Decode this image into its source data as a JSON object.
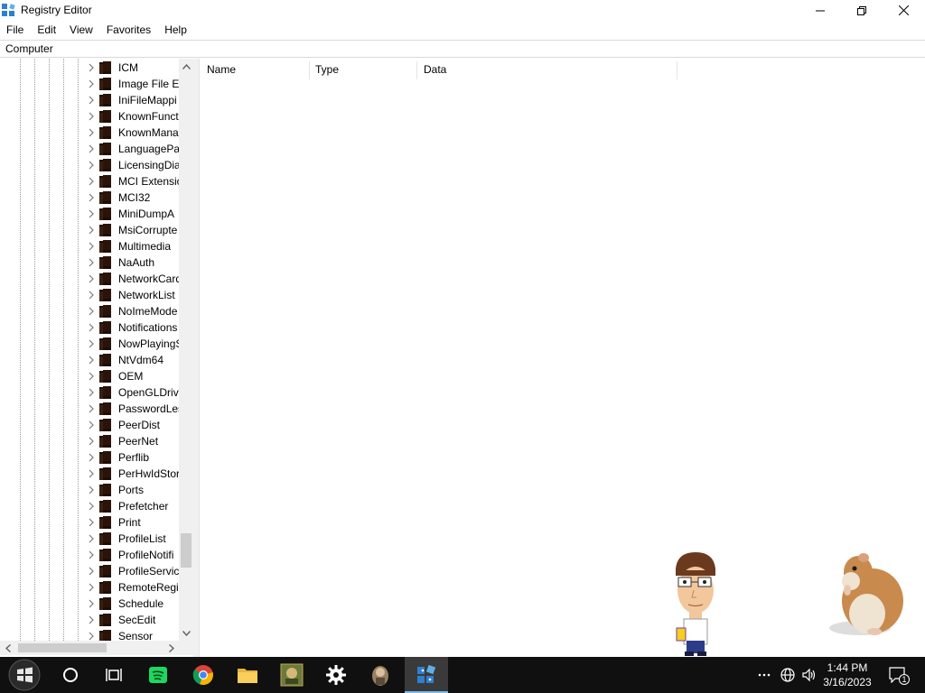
{
  "window": {
    "title": "Registry Editor",
    "icon": "regedit-icon",
    "controls": [
      "minimize-icon",
      "restore-icon",
      "close-icon"
    ]
  },
  "menu": [
    "File",
    "Edit",
    "View",
    "Favorites",
    "Help"
  ],
  "address": "Computer",
  "tree": {
    "items": [
      "ICM",
      "Image File Ex",
      "IniFileMappi",
      "KnownFunct",
      "KnownMana",
      "LanguagePa",
      "LicensingDia",
      "MCI Extensio",
      "MCI32",
      "MiniDumpA",
      "MsiCorrupte",
      "Multimedia",
      "NaAuth",
      "NetworkCard",
      "NetworkList",
      "NoImeMode",
      "Notifications",
      "NowPlayingS",
      "NtVdm64",
      "OEM",
      "OpenGLDrive",
      "PasswordLes",
      "PeerDist",
      "PeerNet",
      "Perflib",
      "PerHwIdStor",
      "Ports",
      "Prefetcher",
      "Print",
      "ProfileList",
      "ProfileNotifi",
      "ProfileServic",
      "RemoteRegis",
      "Schedule",
      "SecEdit",
      "Sensor"
    ]
  },
  "columns": [
    "Name",
    "Type",
    "Data"
  ],
  "taskbar": {
    "apps": [
      "start-icon",
      "cortana-icon",
      "task-view-icon",
      "spotify-icon",
      "chrome-icon",
      "file-explorer-icon",
      "game-app-icon",
      "settings-icon",
      "character-app-icon",
      "regedit-icon"
    ],
    "time": "1:44 PM",
    "date": "3/16/2023",
    "notification_count": "1"
  }
}
